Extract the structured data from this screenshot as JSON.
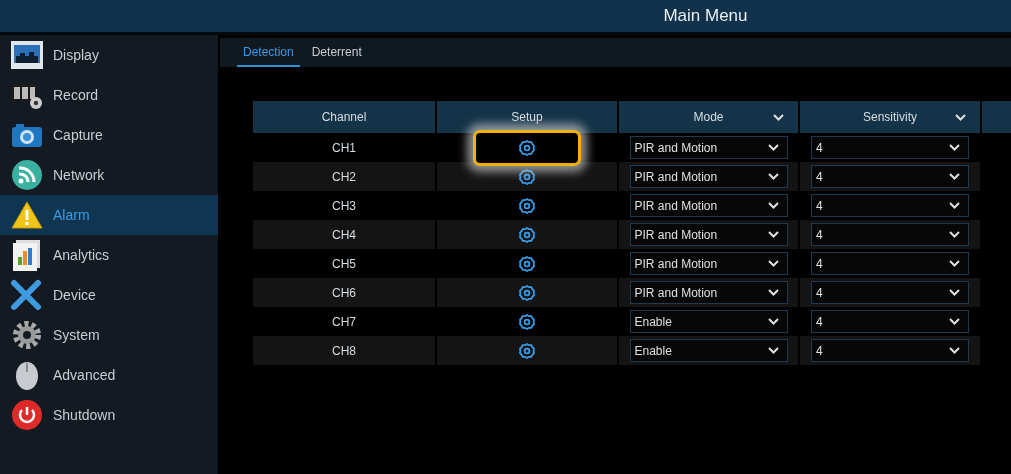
{
  "window": {
    "title": "Main Menu"
  },
  "sidebar": {
    "items": [
      {
        "label": "Display",
        "selected": false
      },
      {
        "label": "Record",
        "selected": false
      },
      {
        "label": "Capture",
        "selected": false
      },
      {
        "label": "Network",
        "selected": false
      },
      {
        "label": "Alarm",
        "selected": true
      },
      {
        "label": "Analytics",
        "selected": false
      },
      {
        "label": "Device",
        "selected": false
      },
      {
        "label": "System",
        "selected": false
      },
      {
        "label": "Advanced",
        "selected": false
      },
      {
        "label": "Shutdown",
        "selected": false
      }
    ]
  },
  "tabs": [
    {
      "label": "Detection",
      "selected": true
    },
    {
      "label": "Deterrent",
      "selected": false
    }
  ],
  "table": {
    "columns": [
      {
        "label": "Channel",
        "kind": "plain"
      },
      {
        "label": "Setup",
        "kind": "plain"
      },
      {
        "label": "Mode",
        "kind": "dropdown"
      },
      {
        "label": "Sensitivity",
        "kind": "dropdown"
      }
    ],
    "rows": [
      {
        "channel": "CH1",
        "setup_highlighted": true,
        "mode": "PIR and Motion",
        "sensitivity": "4"
      },
      {
        "channel": "CH2",
        "setup_highlighted": false,
        "mode": "PIR and Motion",
        "sensitivity": "4"
      },
      {
        "channel": "CH3",
        "setup_highlighted": false,
        "mode": "PIR and Motion",
        "sensitivity": "4"
      },
      {
        "channel": "CH4",
        "setup_highlighted": false,
        "mode": "PIR and Motion",
        "sensitivity": "4"
      },
      {
        "channel": "CH5",
        "setup_highlighted": false,
        "mode": "PIR and Motion",
        "sensitivity": "4"
      },
      {
        "channel": "CH6",
        "setup_highlighted": false,
        "mode": "PIR and Motion",
        "sensitivity": "4"
      },
      {
        "channel": "CH7",
        "setup_highlighted": false,
        "mode": "Enable",
        "sensitivity": "4"
      },
      {
        "channel": "CH8",
        "setup_highlighted": false,
        "mode": "Enable",
        "sensitivity": "4"
      }
    ]
  }
}
